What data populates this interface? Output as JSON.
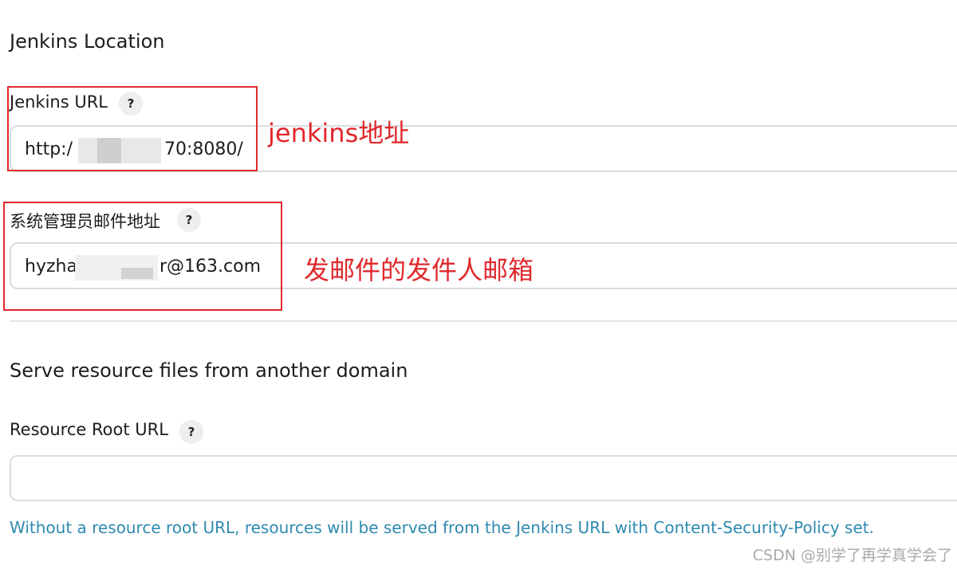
{
  "jenkins_location": {
    "title": "Jenkins Location",
    "url_field": {
      "label": "Jenkins URL",
      "help": "?",
      "value_prefix": "http:/",
      "value_suffix": "70:8080/"
    },
    "email_field": {
      "label": "系统管理员邮件地址",
      "help": "?",
      "value_prefix": "hyzha",
      "value_suffix": "r@163.com"
    }
  },
  "annotations": {
    "url_note": "jenkins地址",
    "email_note": "发邮件的发件人邮箱",
    "color": "#e0282c"
  },
  "resource_domain": {
    "title": "Serve resource files from another domain",
    "root_url_field": {
      "label": "Resource Root URL",
      "help": "?",
      "value": ""
    },
    "hint": "Without a resource root URL, resources will be served from the Jenkins URL with Content-Security-Policy set."
  },
  "watermark": "CSDN @别学了再学真学会了"
}
